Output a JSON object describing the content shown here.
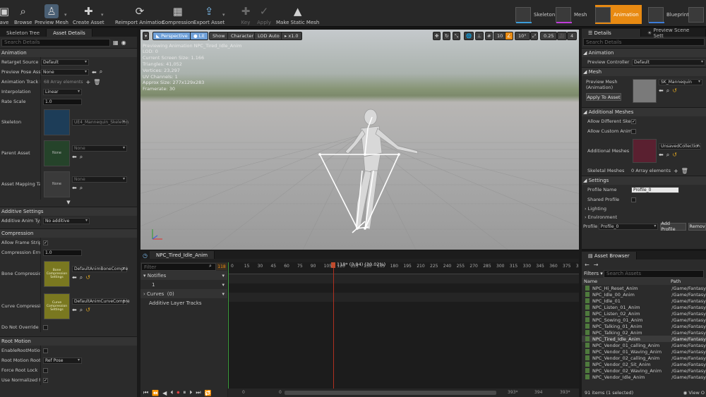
{
  "toolbar": {
    "save": "ave",
    "browse": "Browse",
    "preview_mesh": "Preview Mesh",
    "create_asset": "Create Asset",
    "reimport": "Reimport Animation",
    "compression": "Compression",
    "export": "Export Asset",
    "key": "Key",
    "apply": "Apply",
    "make_static": "Make Static Mesh"
  },
  "modes": {
    "skeleton": "Skeleton",
    "mesh": "Mesh",
    "animation": "Animation",
    "blueprint": "Blueprint",
    "accent_skeleton": "#3c9cd8",
    "accent_mesh": "#c03cd8",
    "accent_anim": "#e88a12",
    "accent_bp": "#3c7cd8"
  },
  "left": {
    "tabs": [
      "Skeleton Tree",
      "Asset Details"
    ],
    "search_placeholder": "Search Details",
    "animation_cat": "Animation",
    "retarget_source_label": "Retarget Source",
    "retarget_source_value": "Default",
    "preview_pose_label": "Preview Pose Asset",
    "preview_pose_value": "None",
    "track_names_label": "Animation Track Nam",
    "track_names_value": "68 Array elements",
    "interpolation_label": "Interpolation",
    "interpolation_value": "Linear",
    "rate_scale_label": "Rate Scale",
    "rate_scale_value": "1.0",
    "skeleton_label": "Skeleton",
    "skeleton_value": "UE4_Mannequin_Skeleton",
    "parent_asset_label": "Parent Asset",
    "parent_asset_value": "None",
    "parent_thumb": "None",
    "mapping_label": "Asset Mapping Table",
    "mapping_value": "None",
    "mapping_thumb": "None",
    "additive_cat": "Additive Settings",
    "additive_type_label": "Additive Anim Type",
    "additive_type_value": "No additive",
    "compression_cat": "Compression",
    "allow_strip_label": "Allow Frame Strippin",
    "error_threshold_label": "Compression Error Th",
    "error_threshold_value": "1.0",
    "bone_comp_label": "Bone Compression Se",
    "bone_comp_thumb": "Bone Compression Settings",
    "bone_comp_value": "DefaultAnimBoneCompre",
    "curve_comp_label": "Curve Compression S",
    "curve_comp_thumb": "Curve Compression Settings",
    "curve_comp_value": "DefaultAnimCurveCompre",
    "no_override_label": "Do Not Override Comp",
    "root_motion_cat": "Root Motion",
    "enable_root_label": "EnableRootMotion",
    "root_lock_label": "Root Motion Root Loc",
    "root_lock_value": "Ref Pose",
    "force_root_label": "Force Root Lock",
    "normalized_root_label": "Use Normalized Root"
  },
  "viewport": {
    "perspective": "Perspective",
    "lit": "Lit",
    "show": "Show",
    "character": "Character",
    "lod": "LOD Auto",
    "speed": "x1.0",
    "grid_snap": "10",
    "rot_snap": "10°",
    "scale_snap": "0.25",
    "cam_speed": "4",
    "stats": [
      "Previewing Animation NPC_Tired_Idle_Anim",
      "LOD: 0",
      "Current Screen Size: 1.166",
      "Triangles: 41,052",
      "Vertices: 23,297",
      "UV Channels: 1",
      "Approx Size: 277x129x283",
      "Framerate: 30"
    ]
  },
  "timeline": {
    "tab": "NPC_Tired_Idle_Anim",
    "filter_placeholder": "Filter",
    "frame_badge": "118",
    "playhead_label": "118* (3.94) (30.02%)",
    "ticks": [
      "0",
      "15",
      "30",
      "45",
      "60",
      "75",
      "90",
      "105",
      "120",
      "135",
      "150",
      "165",
      "180",
      "195",
      "210",
      "225",
      "240",
      "255",
      "270",
      "285",
      "300",
      "315",
      "330",
      "345",
      "360",
      "375",
      "390"
    ],
    "notifies": "Notifies",
    "notify_track": "1",
    "curves": "Curves",
    "curves_count": "(0)",
    "additive_tracks": "Additive Layer Tracks",
    "bottom_left": "0",
    "bottom_mid": "0",
    "bottom_right": "393*",
    "bottom_right2": "394",
    "bottom_right3": "393*"
  },
  "right": {
    "tabs": [
      "Details",
      "Preview Scene Sett"
    ],
    "search_placeholder": "Search Details",
    "animation_cat": "Animation",
    "preview_controller_label": "Preview Controller",
    "preview_controller_value": "Default",
    "mesh_cat": "Mesh",
    "preview_mesh_label": "Preview Mesh (Animation)",
    "preview_mesh_value": "SK_Mannequin",
    "apply_to_asset": "Apply To Asset",
    "additional_meshes_cat": "Additional Meshes",
    "allow_diff_label": "Allow Different Skelet",
    "allow_custom_label": "Allow Custom AnimBl",
    "additional_meshes_label": "Additional Meshes",
    "additional_meshes_value": "UnsavedCollection",
    "skeletal_meshes_label": "Skeletal Meshes",
    "skeletal_meshes_value": "0 Array elements",
    "settings_cat": "Settings",
    "profile_name_label": "Profile Name",
    "profile_name_value": "Profile_0",
    "shared_profile_label": "Shared Profile",
    "lighting": "Lighting",
    "environment": "Environment",
    "profile_label": "Profile",
    "profile_value": "Profile_0",
    "add_profile": "Add Profile",
    "remove": "Remov"
  },
  "asset_browser": {
    "tab": "Asset Browser",
    "filters": "Filters",
    "search_placeholder": "Search Assets",
    "col_name": "Name",
    "col_path": "Path",
    "items": [
      {
        "name": "NPC_Hi_Reset_Anim",
        "path": "/Game/Fantasy"
      },
      {
        "name": "NPC_Idle_00_Anim",
        "path": "/Game/Fantasy"
      },
      {
        "name": "NPC_Idle_01",
        "path": "/Game/Fantasy"
      },
      {
        "name": "NPC_Listen_01_Anim",
        "path": "/Game/Fantasy"
      },
      {
        "name": "NPC_Listen_02_Anim",
        "path": "/Game/Fantasy"
      },
      {
        "name": "NPC_Sowing_01_Anim",
        "path": "/Game/Fantasy"
      },
      {
        "name": "NPC_Talking_01_Anim",
        "path": "/Game/Fantasy"
      },
      {
        "name": "NPC_Talking_02_Anim",
        "path": "/Game/Fantasy"
      },
      {
        "name": "NPC_Tired_Idle_Anim",
        "path": "/Game/Fantasy"
      },
      {
        "name": "NPC_Vendor_01_calling_Anim",
        "path": "/Game/Fantasy"
      },
      {
        "name": "NPC_Vendor_01_Waving_Anim",
        "path": "/Game/Fantasy"
      },
      {
        "name": "NPC_Vendor_02_calling_Anim",
        "path": "/Game/Fantasy"
      },
      {
        "name": "NPC_Vendor_02_Sit_Anim",
        "path": "/Game/Fantasy"
      },
      {
        "name": "NPC_Vendor_02_Waving_Anim",
        "path": "/Game/Fantasy"
      },
      {
        "name": "NPC_Vendor_Idle_Anim",
        "path": "/Game/Fantasy"
      }
    ],
    "status": "91 items (1 selected)",
    "view_options": "View O"
  }
}
